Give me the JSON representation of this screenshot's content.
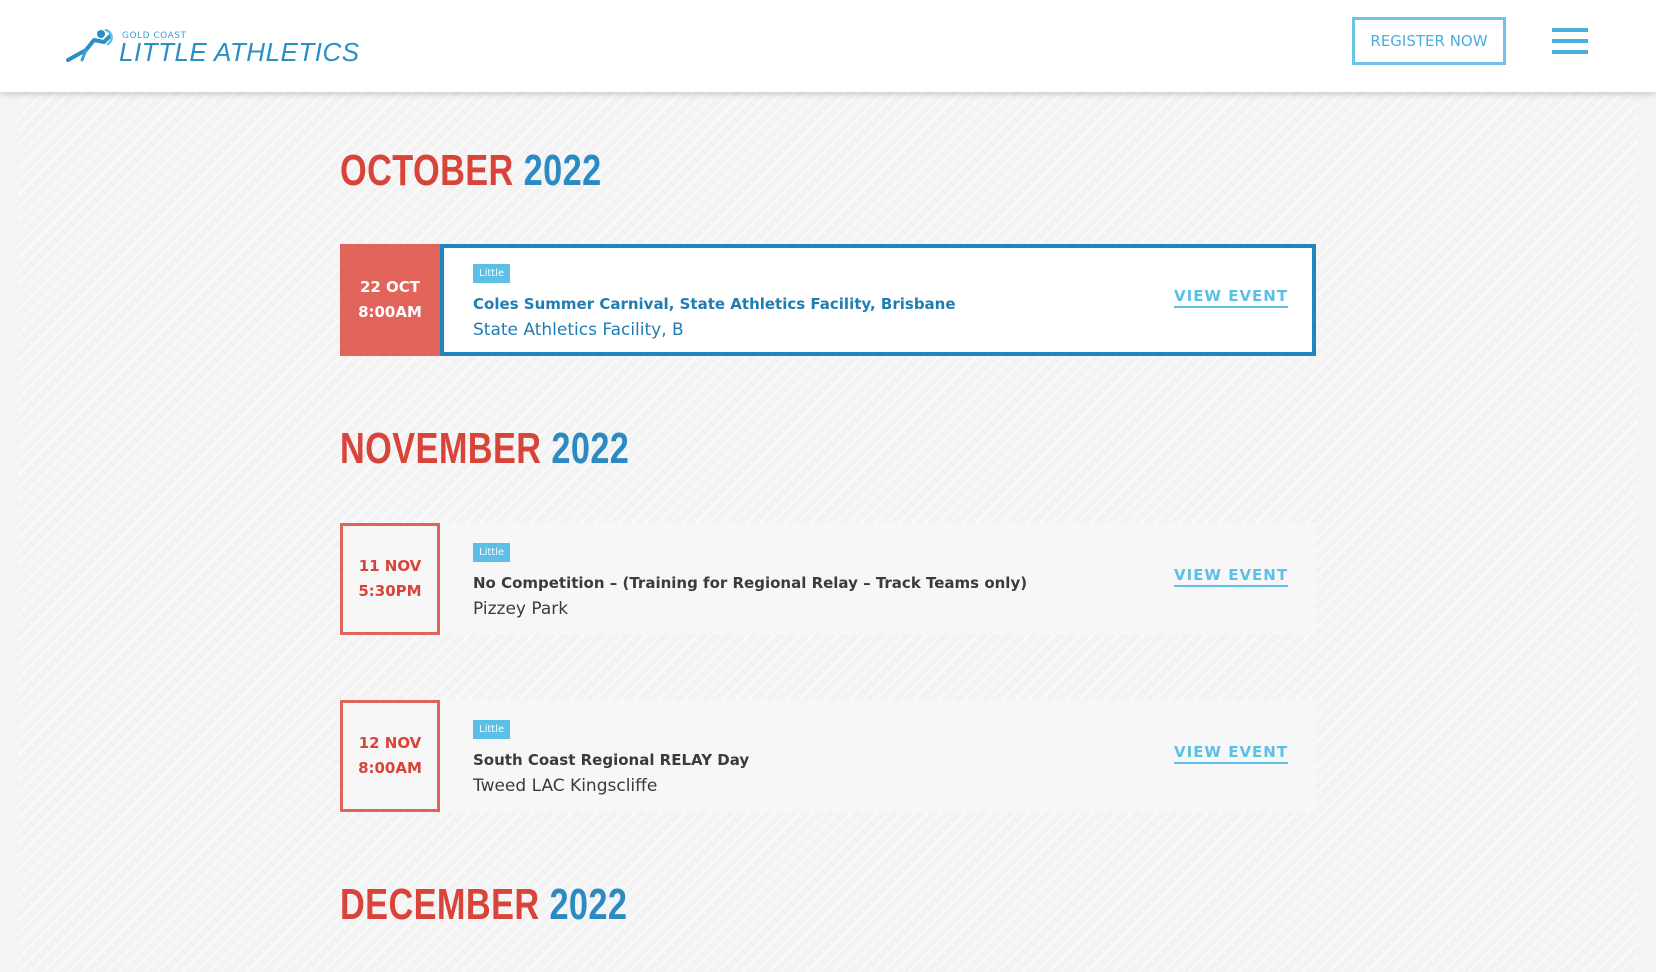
{
  "header": {
    "logo_small": "GOLD COAST",
    "logo_main": "LITTLE ATHLETICS",
    "register_label": "REGISTER NOW",
    "menu_icon": "hamburger-menu-icon"
  },
  "colors": {
    "red": "#e1635a",
    "blue": "#2285bb",
    "light_blue": "#5bbfe6"
  },
  "sections": [
    {
      "month": "OCTOBER",
      "year": "2022",
      "events": [
        {
          "day": "22 OCT",
          "time": "8:00AM",
          "tag": "Little",
          "title": "Coles Summer Carnival, State Athletics Facility, Brisbane",
          "location": "State Athletics Facility, B",
          "link": "VIEW EVENT",
          "active": true
        }
      ]
    },
    {
      "month": "NOVEMBER",
      "year": "2022",
      "events": [
        {
          "day": "11 NOV",
          "time": "5:30PM",
          "tag": "Little",
          "title": "No Competition – (Training for Regional Relay – Track Teams only)",
          "location": "Pizzey Park",
          "link": "VIEW EVENT",
          "active": false
        },
        {
          "day": "12 NOV",
          "time": "8:00AM",
          "tag": "Little",
          "title": "South Coast Regional RELAY Day",
          "location": "Tweed LAC Kingscliffe",
          "link": "VIEW EVENT",
          "active": false
        }
      ]
    },
    {
      "month": "DECEMBER",
      "year": "2022",
      "events": []
    }
  ]
}
